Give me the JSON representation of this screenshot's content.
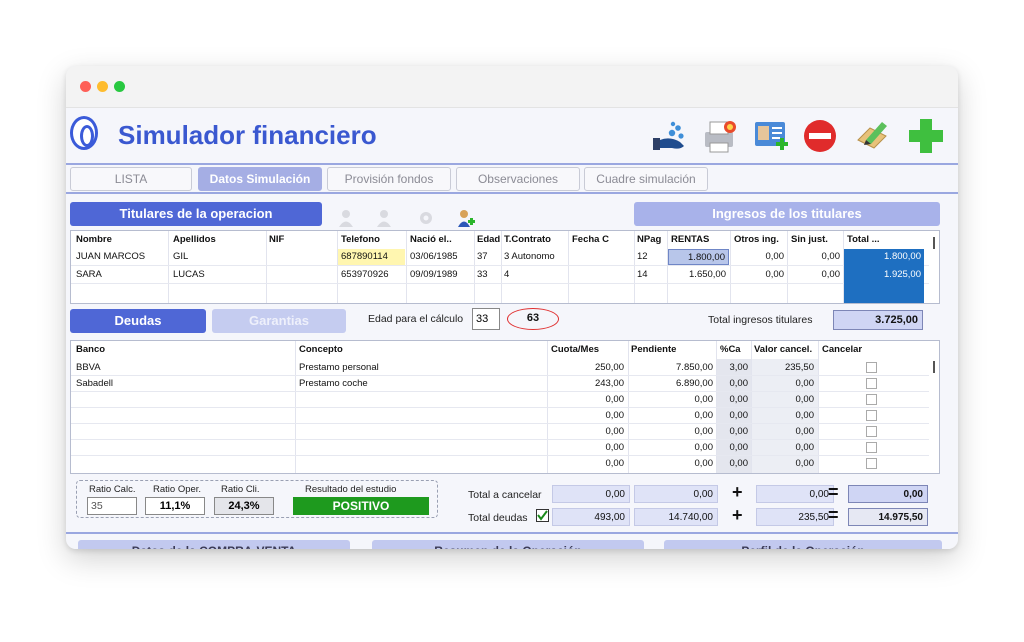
{
  "app": {
    "title": "Simulador financiero",
    "toolbar_icons": [
      "hand-coins-icon",
      "printer-icon",
      "add-contact-card-icon",
      "stop-remove-icon",
      "edit-pencil-icon",
      "add-plus-icon"
    ]
  },
  "tabs": [
    {
      "label": "LISTA",
      "active": false
    },
    {
      "label": "Datos Simulación",
      "active": true
    },
    {
      "label": "Provisión fondos",
      "active": false
    },
    {
      "label": "Observaciones",
      "active": false
    },
    {
      "label": "Cuadre simulación",
      "active": false
    }
  ],
  "titulares": {
    "button": "Titulares de la operacion",
    "ingresos_button": "Ingresos de los titulares",
    "headers": {
      "nombre": "Nombre",
      "apellidos": "Apellidos",
      "nif": "NIF",
      "telefono": "Telefono",
      "nacio": "Nació el..",
      "edad": "Edad",
      "tcontrato": "T.Contrato",
      "fecha_c": "Fecha C",
      "npag": "NPag",
      "rentas": "RENTAS",
      "otros": "Otros ing.",
      "sin_just": "Sin just.",
      "total": "Total ..."
    },
    "rows": [
      {
        "nombre": "JUAN MARCOS",
        "apellidos": "GIL",
        "nif": "",
        "telefono": "687890114",
        "nacio": "03/06/1985",
        "edad": "37",
        "tcontrato": "3 Autonomo",
        "fecha_c": "",
        "npag": "12",
        "rentas": "1.800,00",
        "otros": "0,00",
        "sin_just": "0,00",
        "total": "1.800,00"
      },
      {
        "nombre": "SARA",
        "apellidos": "LUCAS",
        "nif": "",
        "telefono": "653970926",
        "nacio": "09/09/1989",
        "edad": "33",
        "tcontrato": "4",
        "fecha_c": "",
        "npag": "14",
        "rentas": "1.650,00",
        "otros": "0,00",
        "sin_just": "0,00",
        "total": "1.925,00"
      }
    ]
  },
  "deudas": {
    "button": "Deudas",
    "garantias_button": "Garantias",
    "edad_label": "Edad para el cálculo",
    "edad_value": "33",
    "edad_result": "63",
    "total_ingresos_label": "Total ingresos titulares",
    "total_ingresos_value": "3.725,00",
    "headers": {
      "banco": "Banco",
      "concepto": "Concepto",
      "cuota": "Cuota/Mes",
      "pendiente": "Pendiente",
      "pca": "%Ca",
      "valor": "Valor cancel.",
      "cancelar": "Cancelar"
    },
    "rows": [
      {
        "banco": "BBVA",
        "concepto": "Prestamo personal",
        "cuota": "250,00",
        "pendiente": "7.850,00",
        "pca": "3,00",
        "valor": "235,50"
      },
      {
        "banco": "Sabadell",
        "concepto": "Prestamo coche",
        "cuota": "243,00",
        "pendiente": "6.890,00",
        "pca": "0,00",
        "valor": "0,00"
      },
      {
        "banco": "",
        "concepto": "",
        "cuota": "0,00",
        "pendiente": "0,00",
        "pca": "0,00",
        "valor": "0,00"
      },
      {
        "banco": "",
        "concepto": "",
        "cuota": "0,00",
        "pendiente": "0,00",
        "pca": "0,00",
        "valor": "0,00"
      },
      {
        "banco": "",
        "concepto": "",
        "cuota": "0,00",
        "pendiente": "0,00",
        "pca": "0,00",
        "valor": "0,00"
      },
      {
        "banco": "",
        "concepto": "",
        "cuota": "0,00",
        "pendiente": "0,00",
        "pca": "0,00",
        "valor": "0,00"
      },
      {
        "banco": "",
        "concepto": "",
        "cuota": "0,00",
        "pendiente": "0,00",
        "pca": "0,00",
        "valor": "0,00"
      }
    ]
  },
  "ratios": {
    "calc_label": "Ratio Calc.",
    "calc_value": "35",
    "oper_label": "Ratio Oper.",
    "oper_value": "11,1%",
    "cli_label": "Ratio Cli.",
    "cli_value": "24,3%",
    "resultado_label": "Resultado del estudio",
    "resultado_value": "POSITIVO",
    "resultado_color": "#1e9a1e"
  },
  "totales": {
    "cancelar_label": "Total a cancelar",
    "cancelar": [
      "0,00",
      "0,00",
      "0,00",
      "0,00"
    ],
    "deudas_label": "Total deudas",
    "deudas": [
      "493,00",
      "14.740,00",
      "235,50",
      "14.975,50"
    ],
    "plus": "+",
    "equals": "="
  },
  "bottom_buttons": [
    "Datos de la COMPRA-VENTA",
    "Resumen de la Operación",
    "Perfil de la Operación"
  ],
  "colors": {
    "accent": "#4f67d6",
    "total_cell": "#1e6fc1",
    "traffic_red": "#fe5f57",
    "traffic_yellow": "#febc2e",
    "traffic_green": "#28c840"
  }
}
